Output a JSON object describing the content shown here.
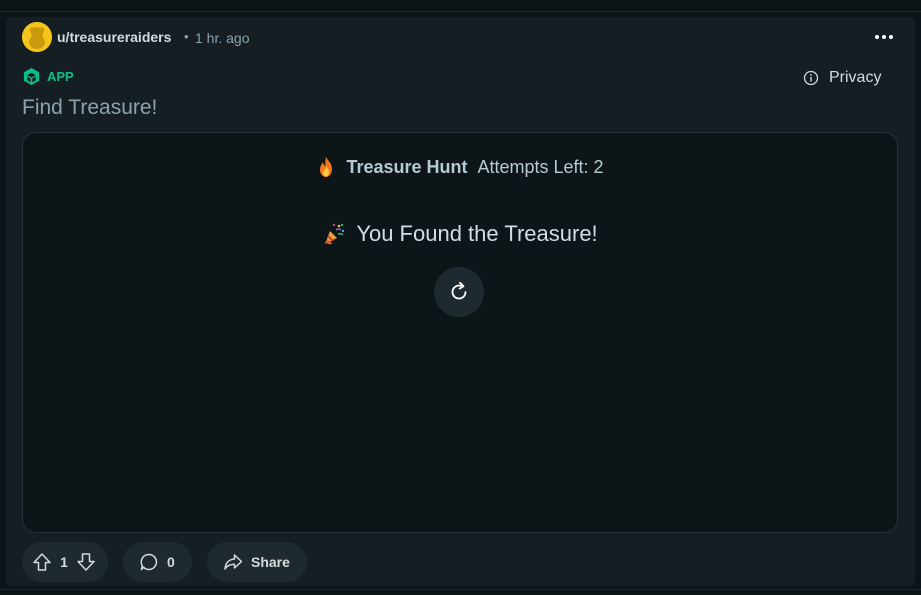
{
  "post": {
    "username": "u/treasureraiders",
    "separator": "•",
    "timestamp": "1 hr. ago",
    "app_badge": "APP",
    "privacy_label": "Privacy",
    "title": "Find Treasure!"
  },
  "game": {
    "title": "Treasure Hunt",
    "attempts_label": "Attempts Left:",
    "attempts_value": "2",
    "result_text": "You Found the Treasure!",
    "icons": {
      "header": "fire-icon",
      "result": "party-popper-icon",
      "restart": "restart-icon"
    }
  },
  "actions": {
    "vote_score": "1",
    "comment_count": "0",
    "share_label": "Share"
  },
  "colors": {
    "page_bg": "#0b1416",
    "card_bg": "#151f23",
    "frame_bg": "#0c1518",
    "app_badge": "#0fbd8c",
    "pill_bg": "#1e2a2e",
    "avatar": "#f5c518"
  }
}
